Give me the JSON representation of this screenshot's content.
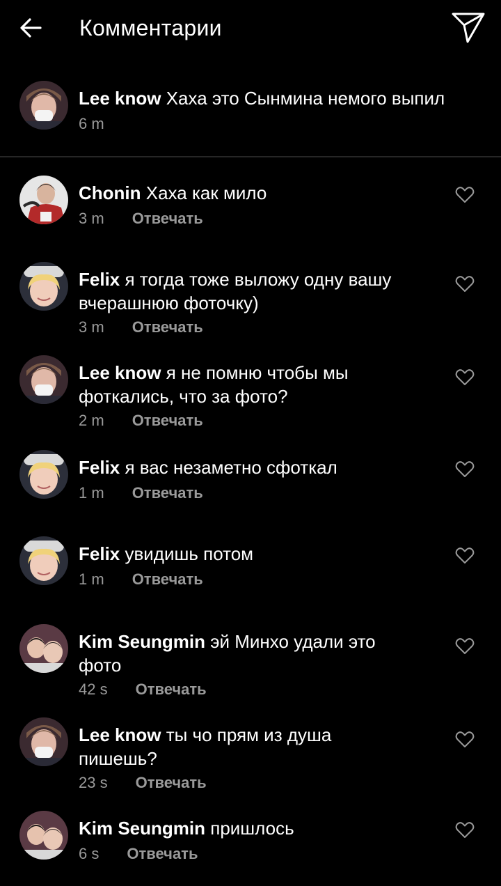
{
  "header": {
    "title": "Комментарии"
  },
  "caption": {
    "username": "Lee know",
    "text": "Хаха это Сынмина немого выпил",
    "time": "6 m"
  },
  "reply_label": "Отвечать",
  "comments": [
    {
      "username": "Chonin",
      "text_line1": "Хаха как мило",
      "text_line2": "",
      "time": "3 m",
      "avatar": "chonin"
    },
    {
      "username": "Felix",
      "text_line1": "я тогда тоже выложу одну вашу",
      "text_line2": "вчерашнюю фоточку)",
      "time": "3 m",
      "avatar": "felix"
    },
    {
      "username": "Lee know",
      "text_line1": "я не помню чтобы мы",
      "text_line2": "фоткались, что за фото?",
      "time": "2 m",
      "avatar": "leeknow"
    },
    {
      "username": "Felix",
      "text_line1": "я вас незаметно сфоткал",
      "text_line2": "",
      "time": "1 m",
      "avatar": "felix"
    },
    {
      "username": "Felix",
      "text_line1": "увидишь потом",
      "text_line2": "",
      "time": "1 m",
      "avatar": "felix"
    },
    {
      "username": "Kim Seungmin",
      "text_line1": "эй Минхо удали это",
      "text_line2": "фото",
      "time": "42 s",
      "avatar": "seungmin"
    },
    {
      "username": "Lee know",
      "text_line1": "ты чо прям из душа",
      "text_line2": "пишешь?",
      "time": "23 s",
      "avatar": "leeknow"
    },
    {
      "username": "Kim Seungmin",
      "text_line1": "пришлось",
      "text_line2": "",
      "time": "6 s",
      "avatar": "seungmin"
    }
  ],
  "icons": {
    "back": "arrow-left-icon",
    "send": "paper-plane-icon",
    "like": "heart-outline-icon"
  },
  "colors": {
    "background": "#000000",
    "text": "#ffffff",
    "muted": "#9a9a9a",
    "divider": "#262626"
  }
}
